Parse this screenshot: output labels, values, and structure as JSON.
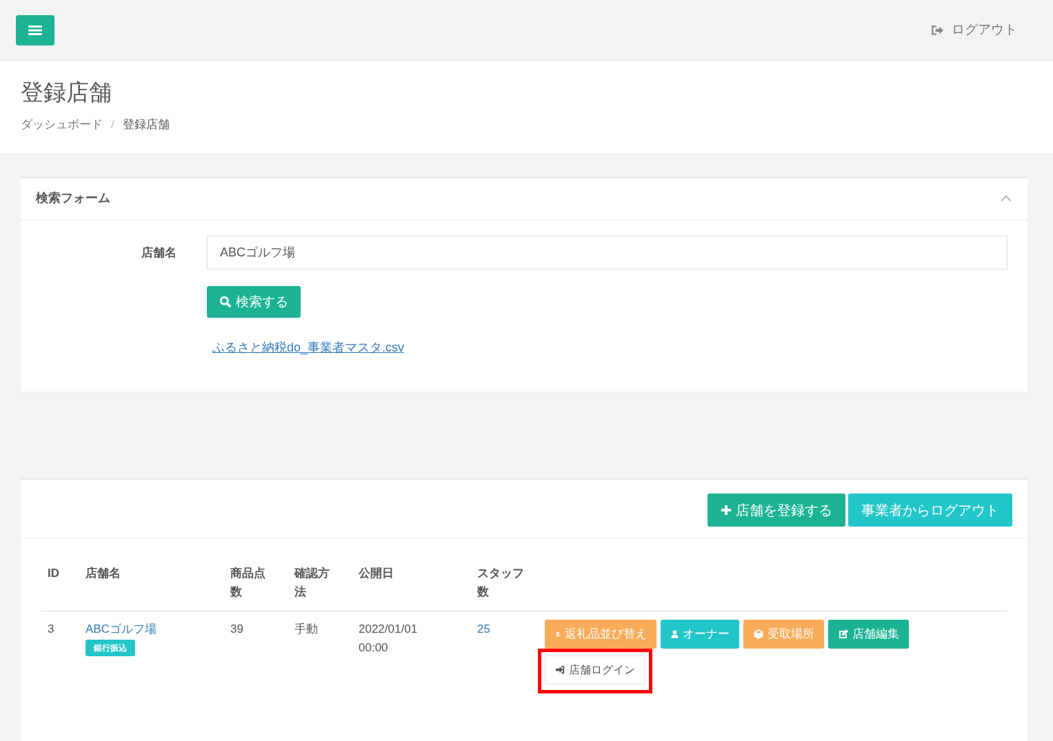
{
  "topbar": {
    "logout": "ログアウト"
  },
  "header": {
    "title": "登録店舗",
    "breadcrumb_separator": "/",
    "breadcrumb": [
      {
        "label": "ダッシュボード",
        "active": false
      },
      {
        "label": "登録店舗",
        "active": true
      }
    ]
  },
  "search_form": {
    "title": "検索フォーム",
    "expanded": true,
    "field_label": "店舗名",
    "field_value": "ABCゴルフ場",
    "search_button": "検索する",
    "csv_link": "ふるさと納税do_事業者マスタ.csv"
  },
  "toolbar": [
    {
      "label": "店舗を登録する",
      "kind": "add"
    },
    {
      "label": "事業者からログアウト",
      "kind": "logout"
    }
  ],
  "table": {
    "columns": [
      "ID",
      "店舗名",
      "商品点数",
      "確認方法",
      "公開日",
      "スタッフ数"
    ],
    "rows": [
      {
        "id": "3",
        "name": "ABCゴルフ場",
        "tag": "銀行振込",
        "items": "39",
        "method": "手動",
        "published": "2022/01/01 00:00",
        "staff": "25",
        "actions": [
          {
            "label": "返礼品並び替え",
            "kind": "sort",
            "highlighted": false
          },
          {
            "label": "オーナー",
            "kind": "owner",
            "highlighted": false
          },
          {
            "label": "受取場所",
            "kind": "place",
            "highlighted": false
          },
          {
            "label": "店舗編集",
            "kind": "edit",
            "highlighted": false
          },
          {
            "label": "店舗ログイン",
            "kind": "login",
            "highlighted": true
          }
        ]
      }
    ]
  }
}
